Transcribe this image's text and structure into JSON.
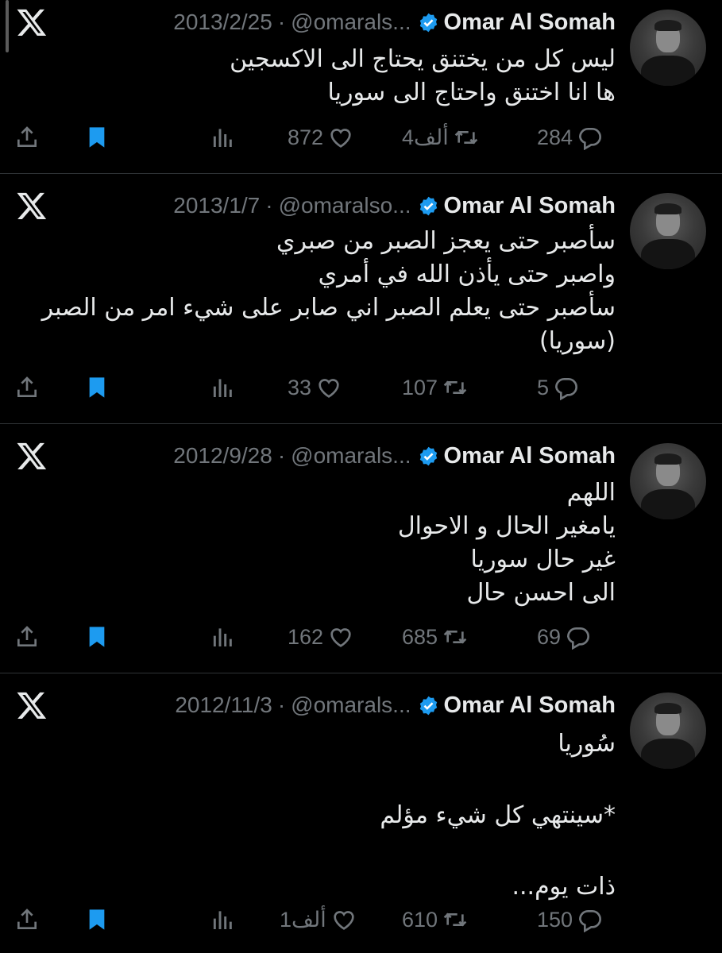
{
  "tweets": [
    {
      "name": "Omar Al Somah",
      "handle": "@omarals...",
      "date": "2013/2/25",
      "lines": [
        "ليس كل من يختنق يحتاج الى الاكسجين",
        "ها انا اختنق واحتاج الى سوريا"
      ],
      "likes": "872",
      "retweets": "4ألف",
      "replies": "284"
    },
    {
      "name": "Omar Al Somah",
      "handle": "@omaralso...",
      "date": "2013/1/7",
      "lines": [
        "سأصبر حتى يعجز الصبر من صبري",
        "واصبر حتى يأذن الله في أمري",
        "سأصبر حتى يعلم الصبر اني صابر على شيء امر من الصبر",
        "(سوريا)"
      ],
      "likes": "33",
      "retweets": "107",
      "replies": "5"
    },
    {
      "name": "Omar Al Somah",
      "handle": "@omarals...",
      "date": "2012/9/28",
      "lines": [
        "اللهم",
        "يامغير الحال و الاحوال",
        "غير حال سوريا",
        "الى احسن حال"
      ],
      "likes": "162",
      "retweets": "685",
      "replies": "69"
    },
    {
      "name": "Omar Al Somah",
      "handle": "@omarals...",
      "date": "2012/11/3",
      "lines": [
        "سُوريا",
        "",
        "*سينتهي كل شيء مؤلم",
        "",
        "ذات يوم..."
      ],
      "likes": "1ألف",
      "retweets": "610",
      "replies": "150"
    }
  ],
  "colors": {
    "background": "#000000",
    "text": "#e7e9ea",
    "muted": "#71767b",
    "bookmark": "#1d9bf0",
    "verified": "#1d9bf0"
  },
  "icons": [
    "x-logo-icon",
    "verified-badge-icon",
    "share-icon",
    "bookmark-icon",
    "views-stats-icon",
    "like-heart-icon",
    "retweet-icon",
    "reply-bubble-icon"
  ]
}
